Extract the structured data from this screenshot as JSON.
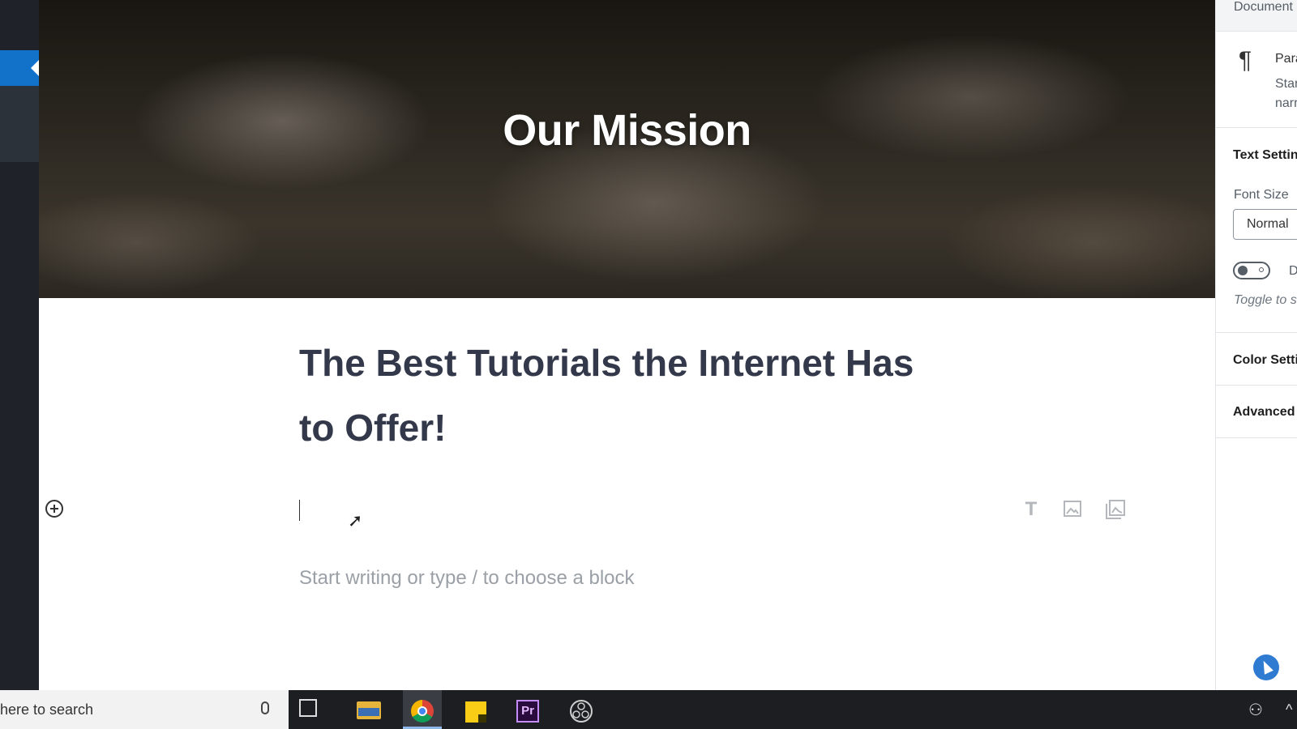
{
  "editor": {
    "cover_title": "Our Mission",
    "heading": "The Best Tutorials the Internet Has to Offer!",
    "placeholder": "Start writing or type / to choose a block",
    "quick_inserters": [
      {
        "icon": "paragraph-T-icon"
      },
      {
        "icon": "image-icon"
      },
      {
        "icon": "gallery-icon"
      }
    ]
  },
  "sidebar": {
    "tab": "Document",
    "block_title": "Para",
    "block_desc_line1": "Star",
    "block_desc_line2": "narr",
    "panels": {
      "text_settings": "Text Settin",
      "font_size_label": "Font Size",
      "font_size_value": "Normal",
      "toggle_label": "D",
      "toggle_help": "Toggle to s",
      "color_settings": "Color Setti",
      "advanced": "Advanced"
    }
  },
  "taskbar": {
    "search_text": "here to search",
    "apps": [
      "task-view",
      "file-explorer",
      "chrome",
      "sticky-notes",
      "premiere-pro",
      "obs"
    ],
    "premiere_label": "Pr"
  },
  "colors": {
    "admin_bar": "#1f2329",
    "admin_active": "#1272c9",
    "heading": "#33394a",
    "placeholder": "#9aa0a6"
  }
}
